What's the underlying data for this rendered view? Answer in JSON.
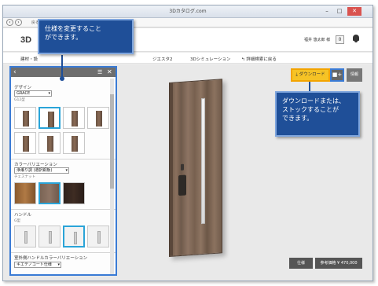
{
  "window": {
    "title": "3Dカタログ.com",
    "address": "戻る"
  },
  "header": {
    "logo": "3D",
    "user": "福井 悠太郎 様",
    "cart_count": "0"
  },
  "breadcrumbs": [
    "建材・設",
    "ジエスタ2",
    "3Dシミュレーション",
    "↰ 詳細検索に戻る"
  ],
  "viewer": {
    "download_label": "⤓ ダウンロード",
    "stock_icon": "camera-plus-icon",
    "info_label": "情報",
    "spec_label": "仕様",
    "price_label": "参考価格 ¥ 470,000"
  },
  "panel": {
    "design": {
      "title": "デザイン",
      "value": "GRACE",
      "sub": "G12型"
    },
    "color": {
      "title": "カラーバリエーション",
      "value": "浄瀬り調 (選択銅板)",
      "sub": "チェスナット"
    },
    "handle": {
      "title": "ハンドル",
      "sub": "G型"
    },
    "outer_handle_color": {
      "title": "室外側ハンドルカラーバリエーション",
      "value": "キエテノコート仕様"
    }
  },
  "callouts": {
    "left": "仕様を変更すること\nができます。",
    "right": "ダウンロードまたは、\nストックすることが\nできます。"
  },
  "colors": {
    "accent_blue": "#3a7bd5",
    "callout_bg": "#1f4f98",
    "download_yellow": "#f6c325"
  }
}
